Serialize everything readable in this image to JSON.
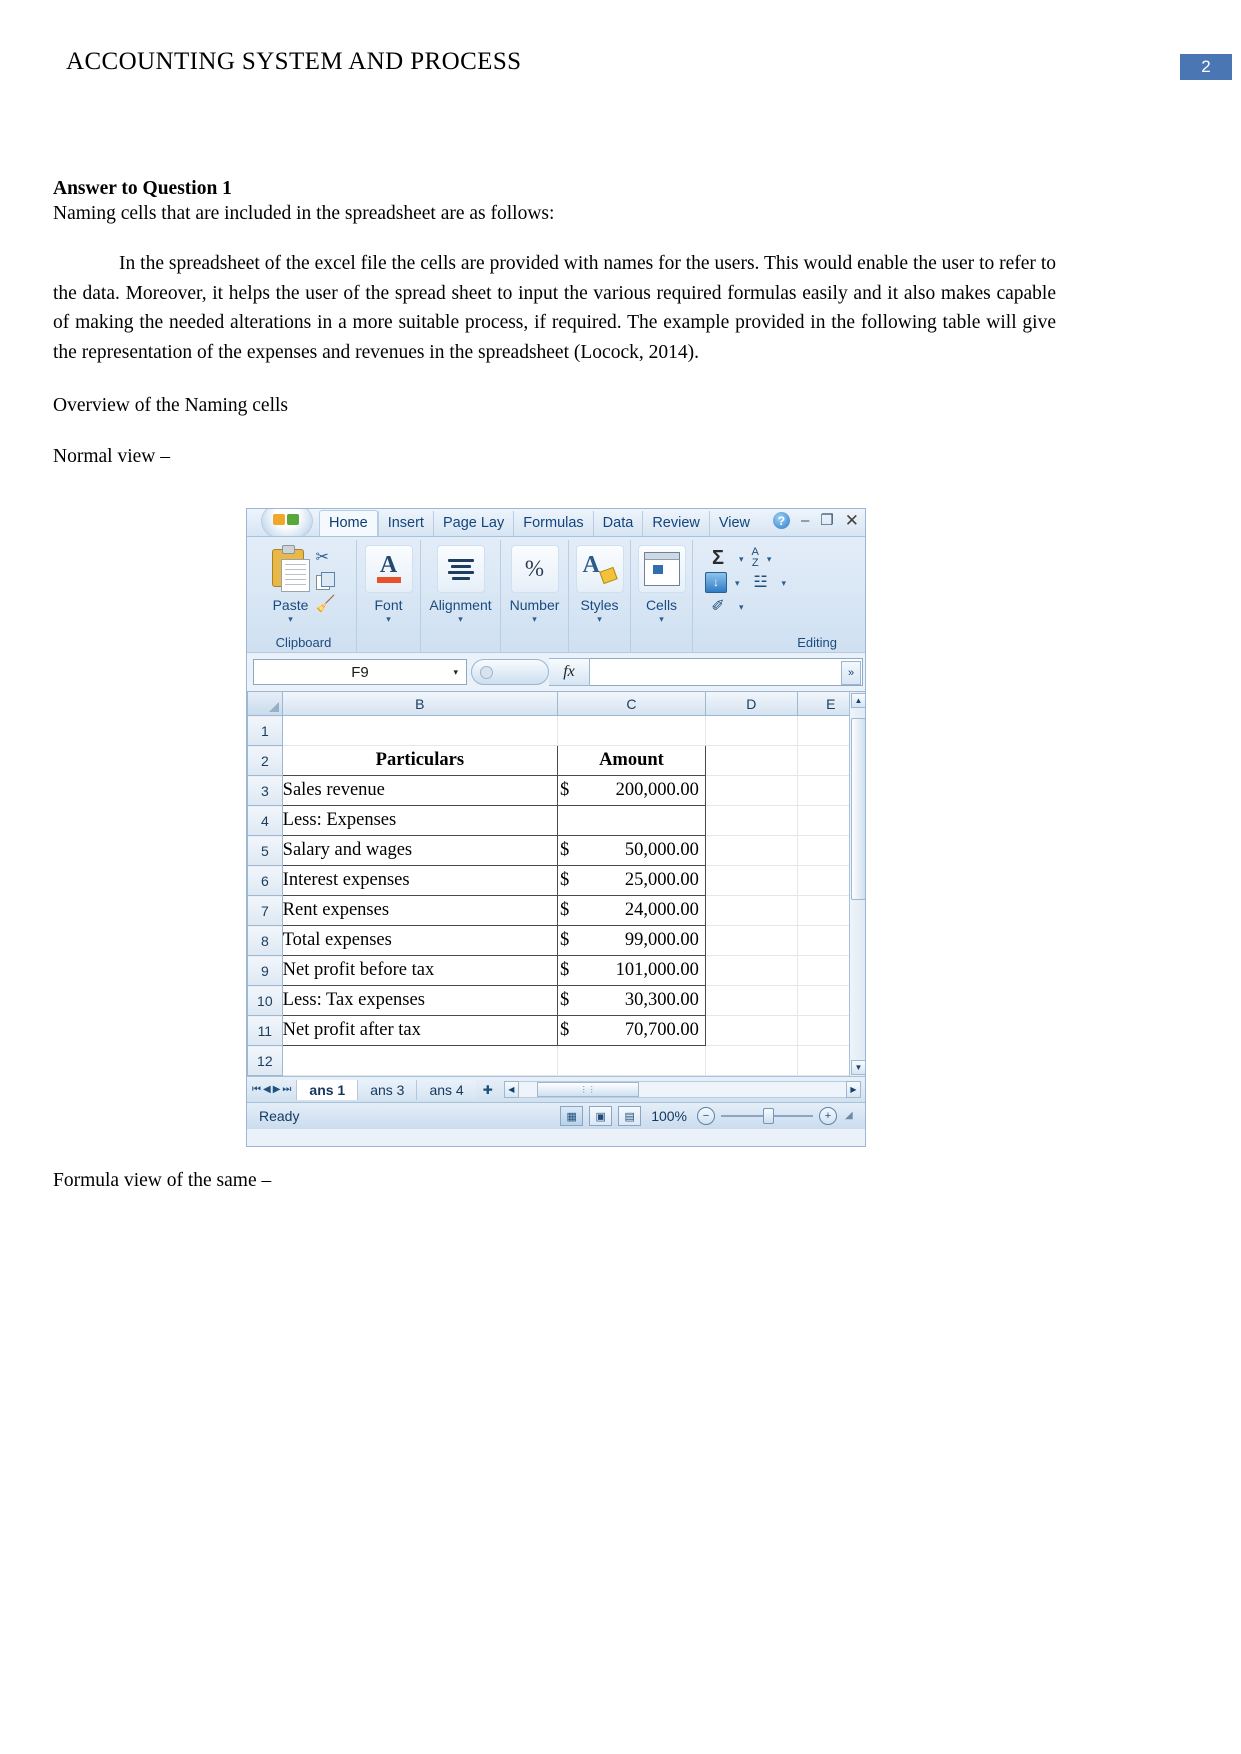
{
  "header": {
    "title": "ACCOUNTING SYSTEM AND PROCESS",
    "page_number": "2",
    "badge_color": "#4a77b4"
  },
  "document": {
    "answer_heading": "Answer to Question 1",
    "intro_line": "Naming cells that are included in the spreadsheet are as follows:",
    "paragraph": "In the spreadsheet of the excel file the cells are provided with names for the users. This would enable the user to refer to the data. Moreover, it helps the user of the spread sheet to input the various required formulas easily and it also makes capable of making the needed alterations in a more suitable process, if required. The example provided in the following table will give the representation of the expenses and revenues in the spreadsheet (Locock, 2014).",
    "overview_label": "Overview of the Naming cells",
    "normal_view_label": "Normal view –",
    "formula_view_label": "Formula view of the same –"
  },
  "excel": {
    "office_orb": "office-orb",
    "ribbon_tabs": [
      {
        "label": "Home",
        "active": true
      },
      {
        "label": "Insert",
        "active": false
      },
      {
        "label": "Page Lay",
        "active": false
      },
      {
        "label": "Formulas",
        "active": false
      },
      {
        "label": "Data",
        "active": false
      },
      {
        "label": "Review",
        "active": false
      },
      {
        "label": "View",
        "active": false
      }
    ],
    "window_controls": {
      "help": "?",
      "minimize": "–",
      "restore": "❐",
      "close": "✕"
    },
    "ribbon_groups": {
      "clipboard_label": "Clipboard",
      "paste_label": "Paste",
      "font_label": "Font",
      "alignment_label": "Alignment",
      "number_label": "Number",
      "styles_label": "Styles",
      "cells_label": "Cells",
      "editing_label": "Editing",
      "number_symbol": "%",
      "font_symbol": "A",
      "styles_symbol": "A",
      "sum_symbol": "Σ",
      "sort_symbol_top": "A",
      "sort_symbol_bottom": "Z",
      "find_symbol": "☳",
      "clear_symbol": "✐",
      "caret": "▾"
    },
    "formula_bar": {
      "name_box_value": "F9",
      "fx_label": "fx",
      "formula_value": "",
      "name_box_caret": "▾",
      "expand_caret": "»"
    },
    "grid": {
      "columns": [
        "B",
        "C",
        "D",
        "E"
      ],
      "rows": [
        {
          "num": "1",
          "particulars": "",
          "amount": "",
          "boxed": false
        },
        {
          "num": "2",
          "particulars": "Particulars",
          "amount": "Amount",
          "boxed": true,
          "header": true
        },
        {
          "num": "3",
          "particulars": "Sales revenue",
          "amount_symbol": "$",
          "amount_value": "200,000.00",
          "boxed": true
        },
        {
          "num": "4",
          "particulars": "Less: Expenses",
          "amount_symbol": "",
          "amount_value": "",
          "boxed": true
        },
        {
          "num": "5",
          "particulars": "Salary and wages",
          "amount_symbol": "$",
          "amount_value": "50,000.00",
          "boxed": true
        },
        {
          "num": "6",
          "particulars": "Interest expenses",
          "amount_symbol": "$",
          "amount_value": "25,000.00",
          "boxed": true
        },
        {
          "num": "7",
          "particulars": "Rent expenses",
          "amount_symbol": "$",
          "amount_value": "24,000.00",
          "boxed": true
        },
        {
          "num": "8",
          "particulars": "Total expenses",
          "amount_symbol": "$",
          "amount_value": "99,000.00",
          "boxed": true
        },
        {
          "num": "9",
          "particulars": "Net profit before tax",
          "amount_symbol": "$",
          "amount_value": "101,000.00",
          "boxed": true
        },
        {
          "num": "10",
          "particulars": "Less: Tax expenses",
          "amount_symbol": "$",
          "amount_value": "30,300.00",
          "boxed": true
        },
        {
          "num": "11",
          "particulars": "Net profit after tax",
          "amount_symbol": "$",
          "amount_value": "70,700.00",
          "boxed": true
        },
        {
          "num": "12",
          "particulars": "",
          "amount_symbol": "",
          "amount_value": "",
          "boxed": false
        }
      ]
    },
    "sheet_tabs": [
      {
        "label": "ans 1",
        "active": true
      },
      {
        "label": "ans 3",
        "active": false
      },
      {
        "label": "ans 4",
        "active": false
      }
    ],
    "sheet_nav": {
      "first": "⏮",
      "prev": "◀",
      "next": "▶",
      "last": "⏭",
      "new_sheet": "✚"
    },
    "status_bar": {
      "status": "Ready",
      "zoom": "100%",
      "zoom_out": "−",
      "zoom_in": "+",
      "view_normal": "▦",
      "view_layout": "▣",
      "view_break": "▤"
    }
  }
}
